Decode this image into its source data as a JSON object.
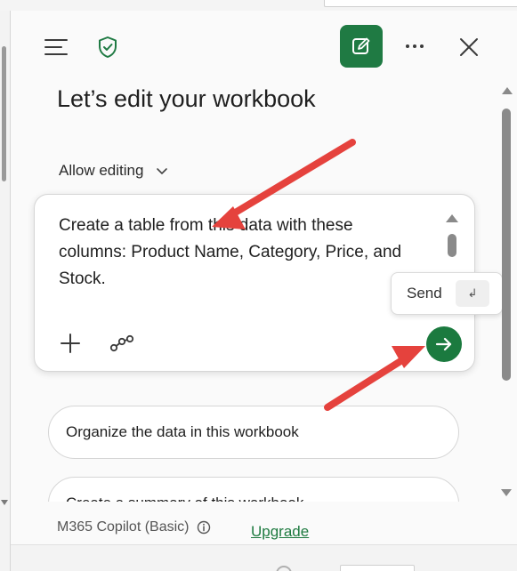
{
  "header": {
    "menu_icon": "hamburger-menu-icon",
    "shield_icon": "shield-check-icon",
    "new_chat_icon": "compose-icon",
    "more_icon": "more-horizontal-icon",
    "close_icon": "close-icon"
  },
  "main": {
    "title": "Let’s edit your workbook",
    "mode_label": "Allow editing",
    "prompt_text": "Create a table from this data with these columns: Product Name, Category, Price, and Stock.",
    "send_tooltip_label": "Send",
    "send_tooltip_key": "↲",
    "suggestions": [
      {
        "label": "Organize the data in this workbook"
      },
      {
        "label": "Create a summary of this workbook"
      }
    ]
  },
  "footer": {
    "plan_label": "M365 Copilot (Basic)",
    "upgrade_label": "Upgrade"
  },
  "colors": {
    "accent_green": "#1f7a43",
    "annotation_red": "#e5423d"
  }
}
